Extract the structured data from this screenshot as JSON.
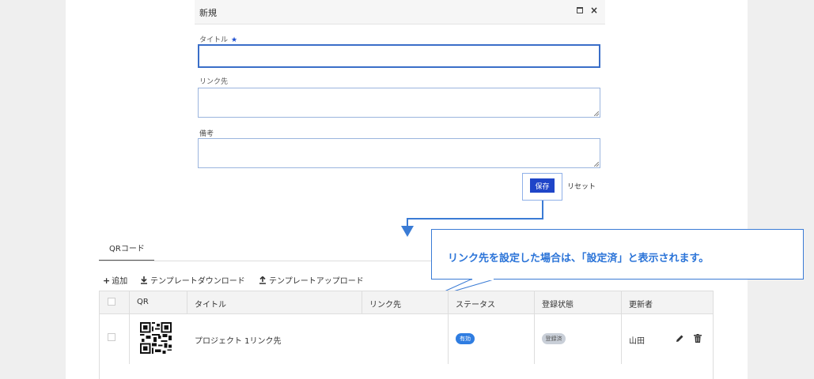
{
  "dialog": {
    "title": "新規",
    "maximize_icon": "maximize-icon",
    "close_label": "×",
    "fields": {
      "title_label": "タイトル",
      "title_required": "★",
      "title_value": "",
      "link_label": "リンク先",
      "link_value": "",
      "note_label": "備考",
      "note_value": ""
    },
    "save_label": "保存",
    "reset_label": "リセット"
  },
  "callout": {
    "text": "リンク先を設定した場合は、「設定済」と表示されます。",
    "color": "#2b74d8"
  },
  "tabs": [
    {
      "label": "QRコード",
      "active": true
    }
  ],
  "toolbar": {
    "add": {
      "icon": "+",
      "label": "追加"
    },
    "template_download": {
      "icon": "download-icon",
      "label": "テンプレートダウンロード"
    },
    "template_upload": {
      "icon": "upload-icon",
      "label": "テンプレートアップロード"
    }
  },
  "table": {
    "headers": [
      "QR",
      "タイトル",
      "リンク先",
      "ステータス",
      "登録状態",
      "更新者"
    ],
    "rows": [
      {
        "title": "プロジェクト 1リンク先",
        "link": "",
        "status": "有効",
        "registration": "登録済",
        "updated_by": "山田"
      }
    ]
  },
  "colors": {
    "primary": "#1f45c8",
    "status_active": "#2f7de1",
    "registered_badge": "#c9cfd8"
  }
}
